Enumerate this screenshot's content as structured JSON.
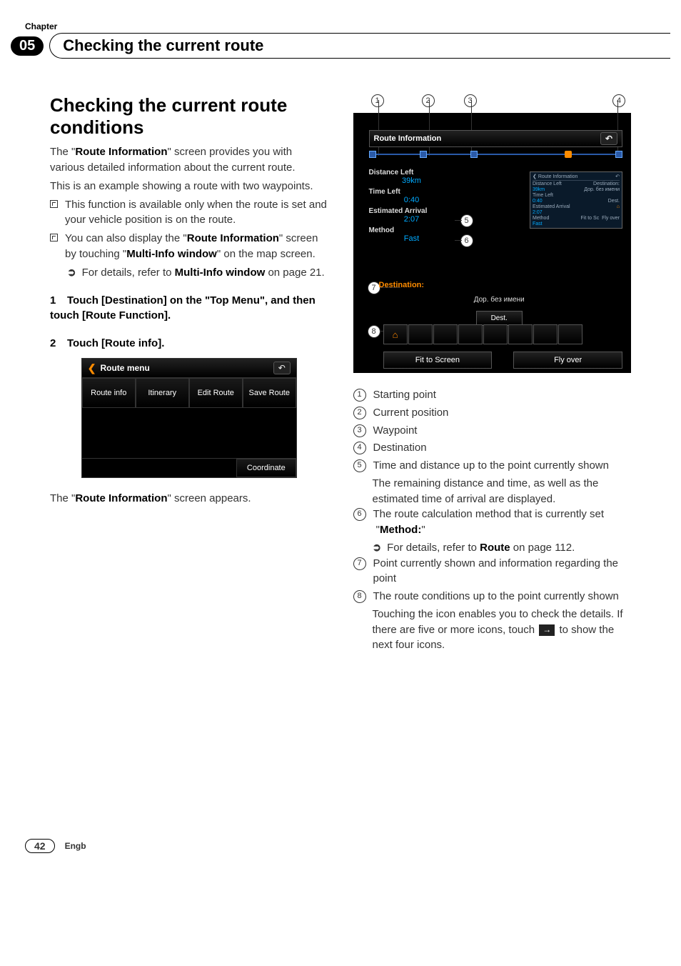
{
  "header": {
    "topLabel": "Chapter",
    "chapterNumber": "05",
    "title": "Checking the current route"
  },
  "left": {
    "sectionTitle": "Checking the current route conditions",
    "intro1a": "The \"",
    "intro1b": "Route Information",
    "intro1c": "\" screen provides you with various detailed information about the current route.",
    "intro2": "This is an example showing a route with two waypoints.",
    "note1": "This function is available only when the route is set and your vehicle position is on the route.",
    "note2a": "You can also display the \"",
    "note2b": "Route Information",
    "note2c": "\" screen by touching \"",
    "note2d": "Multi-Info window",
    "note2e": "\" on the map screen.",
    "ref1a": "For details, refer to ",
    "ref1b": "Multi-Info window",
    "ref1c": " on page 21.",
    "step1num": "1",
    "step1": "Touch [Destination] on the \"Top Menu\", and then touch [Route Function].",
    "step2num": "2",
    "step2": "Touch [Route info].",
    "routeMenu": {
      "title": "Route menu",
      "buttons": [
        "Route info",
        "Itinerary",
        "Edit Route",
        "Save Route"
      ],
      "footerBtn": "Coordinate"
    },
    "afterImg1a": "The \"",
    "afterImg1b": "Route Information",
    "afterImg1c": "\" screen appears."
  },
  "right": {
    "topCallouts": [
      "1",
      "2",
      "3",
      "4"
    ],
    "sideCallouts": [
      "5",
      "6",
      "7",
      "8"
    ],
    "riHeader": "Route Information",
    "info": {
      "distanceLeftLabel": "Distance Left",
      "distanceLeftValue": "39km",
      "timeLeftLabel": "Time Left",
      "timeLeftValue": "0:40",
      "etaLabel": "Estimated Arrival",
      "etaValue": "2:07",
      "methodLabel": "Method",
      "methodValue": "Fast"
    },
    "mini": {
      "header": "Route Information",
      "c1": "Distance Left",
      "c2": "Destination:",
      "v1": "39km",
      "v2": "Дор. без имени",
      "c3": "Time Left",
      "v3": "0:40",
      "v3b": "Dest.",
      "c4": "Estimated Arrival",
      "v4": "2:07",
      "c5": "Method",
      "v5": "Fast",
      "b1": "Fit to Sc",
      "b2": "Fly over"
    },
    "dest": {
      "label": "Destination:",
      "text": "Дор. без имени",
      "btn": "Dest."
    },
    "bottomButtons": [
      "Fit to Screen",
      "Fly over"
    ],
    "legend": {
      "i1": "Starting point",
      "i2": "Current position",
      "i3": "Waypoint",
      "i4": "Destination",
      "i5": "Time and distance up to the point currently shown",
      "i5sub": "The remaining distance and time, as well as the estimated time of arrival are displayed.",
      "i6a": "The route calculation method that is currently set  \"",
      "i6b": "Method:",
      "i6c": "\"",
      "i6refA": "For details, refer to ",
      "i6refB": "Route",
      "i6refC": " on page 112.",
      "i7": "Point currently shown and information regarding the point",
      "i8": "The route conditions up to the point currently shown",
      "i8subA": "Touching the icon enables you to check the details. If there are five or more icons, touch ",
      "i8subB": " to show the next four icons."
    }
  },
  "footer": {
    "pageNumber": "42",
    "label": "Engb"
  }
}
